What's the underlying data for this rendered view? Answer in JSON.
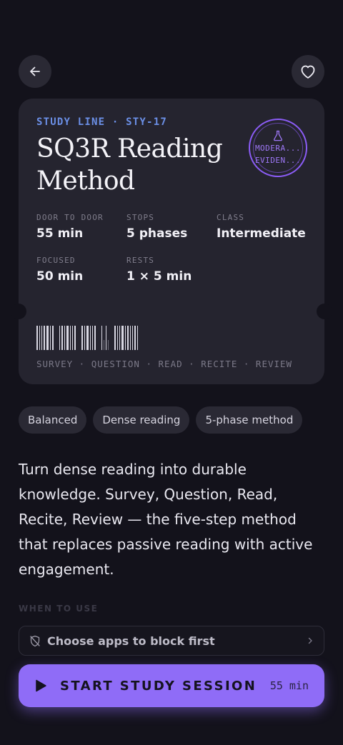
{
  "header": {
    "back_icon": "arrow-left-icon",
    "favorite_icon": "heart-outline-icon"
  },
  "ticket": {
    "line_label": "STUDY LINE · STY-17",
    "title": "SQ3R Reading Method",
    "stamp": {
      "icon": "flask-icon",
      "line1": "MODERA...",
      "line2": "EVIDEN..."
    },
    "stats": [
      {
        "key": "DOOR TO DOOR",
        "value": "55 min"
      },
      {
        "key": "STOPS",
        "value": "5 phases"
      },
      {
        "key": "CLASS",
        "value": "Intermediate"
      },
      {
        "key": "FOCUSED",
        "value": "50 min"
      },
      {
        "key": "RESTS",
        "value": "1 × 5 min"
      }
    ],
    "phases": "SURVEY · QUESTION · READ · RECITE · REVIEW"
  },
  "tags": [
    "Balanced",
    "Dense reading",
    "5-phase method"
  ],
  "description": "Turn dense reading into durable knowledge. Survey, Question, Read, Recite, Review — the five-step method that replaces passive reading with active engagement.",
  "when_to_use_label": "WHEN TO USE",
  "block_apps": {
    "icon": "shield-off-icon",
    "label": "Choose apps to block first"
  },
  "cta": {
    "icon": "play-icon",
    "label": "START STUDY SESSION",
    "duration": "55 min"
  },
  "colors": {
    "background": "#13121b",
    "card": "#25242f",
    "accent": "#8f6cf7",
    "line_label": "#6b8fe6"
  }
}
